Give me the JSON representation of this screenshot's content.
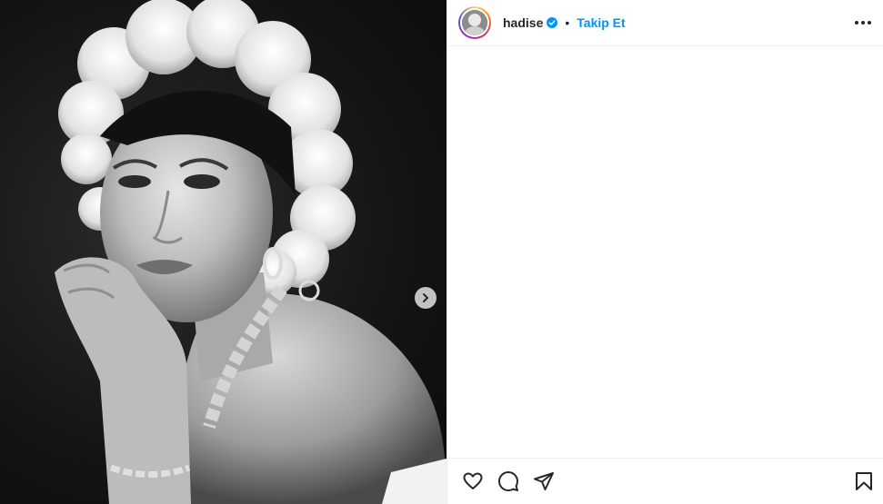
{
  "post": {
    "username": "hadise",
    "separator": "•",
    "follow_label": "Takip Et"
  },
  "icons": {
    "verified": "verified-badge-icon",
    "more": "more-options-icon",
    "next": "chevron-right-icon",
    "like": "heart-icon",
    "comment": "comment-icon",
    "share": "paper-plane-icon",
    "save": "bookmark-icon"
  },
  "colors": {
    "accent": "#0095f6",
    "text": "#262626",
    "divider": "#efefef"
  }
}
